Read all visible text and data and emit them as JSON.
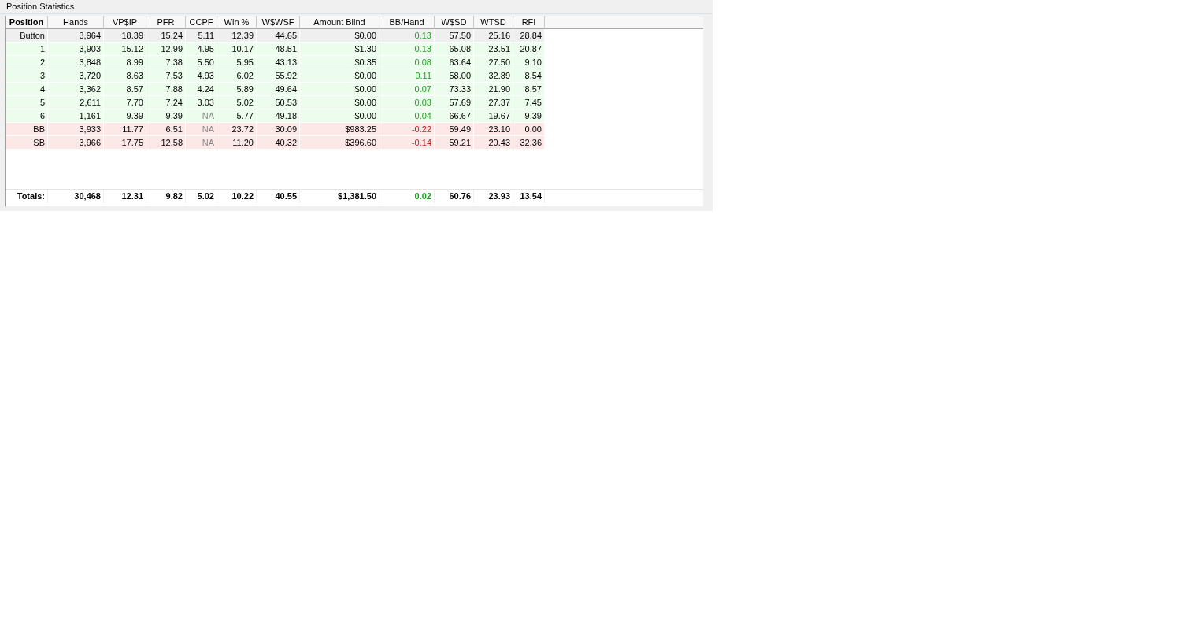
{
  "panel": {
    "title": "Position Statistics"
  },
  "table": {
    "columns": [
      "Position",
      "Hands",
      "VP$IP",
      "PFR",
      "CCPF",
      "Win %",
      "W$WSF",
      "Amount Blind",
      "BB/Hand",
      "W$SD",
      "WTSD",
      "RFI"
    ],
    "rows": [
      {
        "selected": true,
        "kind": "win",
        "ccpf_na": false,
        "cells": [
          "Button",
          "3,964",
          "18.39",
          "15.24",
          "5.11",
          "12.39",
          "44.65",
          "$0.00",
          "0.13",
          "57.50",
          "25.16",
          "28.84"
        ]
      },
      {
        "selected": false,
        "kind": "win",
        "ccpf_na": false,
        "cells": [
          "1",
          "3,903",
          "15.12",
          "12.99",
          "4.95",
          "10.17",
          "48.51",
          "$1.30",
          "0.13",
          "65.08",
          "23.51",
          "20.87"
        ]
      },
      {
        "selected": false,
        "kind": "win",
        "ccpf_na": false,
        "cells": [
          "2",
          "3,848",
          "8.99",
          "7.38",
          "5.50",
          "5.95",
          "43.13",
          "$0.35",
          "0.08",
          "63.64",
          "27.50",
          "9.10"
        ]
      },
      {
        "selected": false,
        "kind": "win",
        "ccpf_na": false,
        "cells": [
          "3",
          "3,720",
          "8.63",
          "7.53",
          "4.93",
          "6.02",
          "55.92",
          "$0.00",
          "0.11",
          "58.00",
          "32.89",
          "8.54"
        ]
      },
      {
        "selected": false,
        "kind": "win",
        "ccpf_na": false,
        "cells": [
          "4",
          "3,362",
          "8.57",
          "7.88",
          "4.24",
          "5.89",
          "49.64",
          "$0.00",
          "0.07",
          "73.33",
          "21.90",
          "8.57"
        ]
      },
      {
        "selected": false,
        "kind": "win",
        "ccpf_na": false,
        "cells": [
          "5",
          "2,611",
          "7.70",
          "7.24",
          "3.03",
          "5.02",
          "50.53",
          "$0.00",
          "0.03",
          "57.69",
          "27.37",
          "7.45"
        ]
      },
      {
        "selected": false,
        "kind": "win",
        "ccpf_na": true,
        "cells": [
          "6",
          "1,161",
          "9.39",
          "9.39",
          "NA",
          "5.77",
          "49.18",
          "$0.00",
          "0.04",
          "66.67",
          "19.67",
          "9.39"
        ]
      },
      {
        "selected": false,
        "kind": "loss",
        "ccpf_na": true,
        "cells": [
          "BB",
          "3,933",
          "11.77",
          "6.51",
          "NA",
          "23.72",
          "30.09",
          "$983.25",
          "-0.22",
          "59.49",
          "23.10",
          "0.00"
        ]
      },
      {
        "selected": false,
        "kind": "loss",
        "ccpf_na": true,
        "cells": [
          "SB",
          "3,966",
          "17.75",
          "12.58",
          "NA",
          "11.20",
          "40.32",
          "$396.60",
          "-0.14",
          "59.21",
          "20.43",
          "32.36"
        ]
      }
    ],
    "totals": {
      "kind": "win",
      "cells": [
        "Totals:",
        "30,468",
        "12.31",
        "9.82",
        "5.02",
        "10.22",
        "40.55",
        "$1,381.50",
        "0.02",
        "60.76",
        "23.93",
        "13.54"
      ]
    }
  }
}
